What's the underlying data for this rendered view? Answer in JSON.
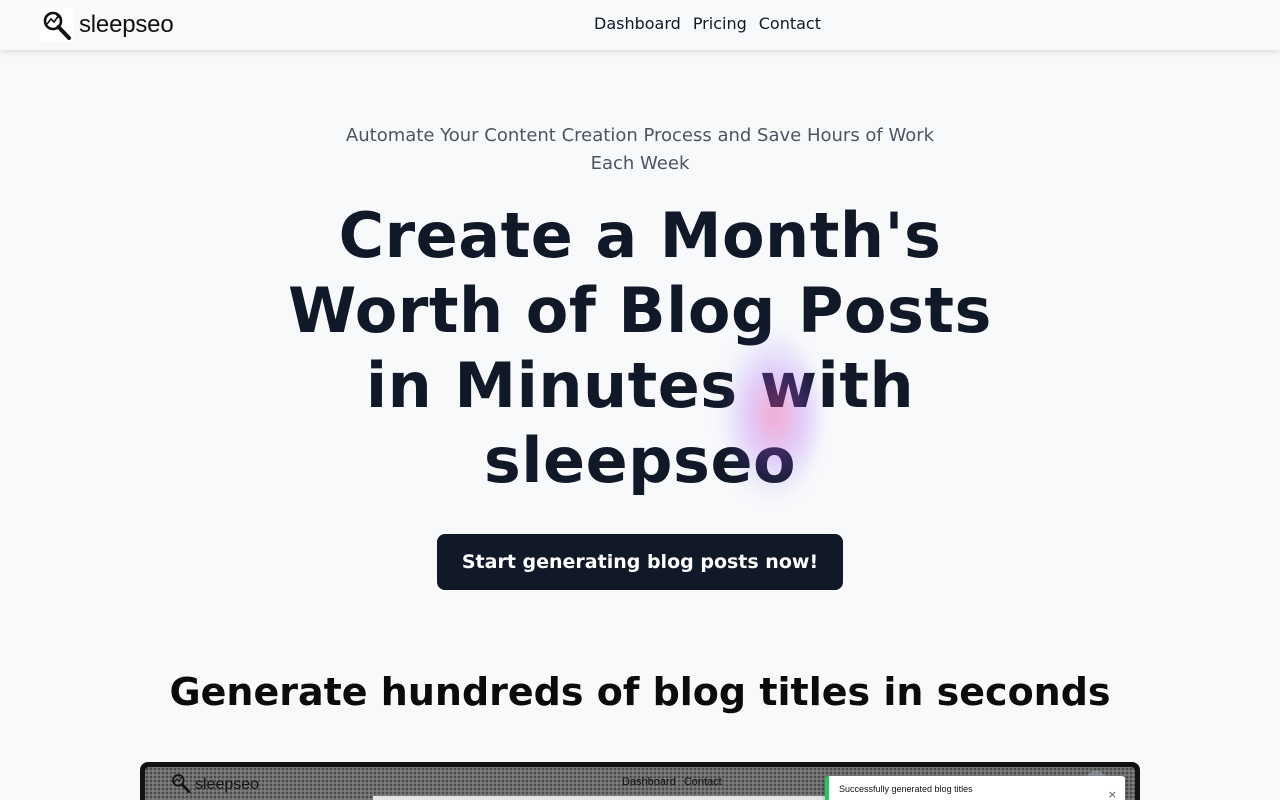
{
  "header": {
    "logo_text": "sleepseo",
    "logo_icon": "magnifier-arrow-icon",
    "nav": [
      "Dashboard",
      "Pricing",
      "Contact"
    ]
  },
  "hero": {
    "tagline": "Automate Your Content Creation Process and Save Hours of Work Each Week",
    "headline": "Create a Month's Worth of Blog Posts in Minutes with sleepseo",
    "cta_label": "Start generating blog posts now!"
  },
  "section": {
    "title": "Generate hundreds of blog titles in seconds"
  },
  "preview": {
    "logo_text": "sleepseo",
    "nav": [
      "Dashboard",
      "Contact"
    ],
    "toast_text": "Successfully generated blog titles",
    "toast_close": "×"
  },
  "colors": {
    "background": "#f8f9fb",
    "primary": "#111827",
    "muted_text": "#4b5563",
    "toast_success": "#22c55e"
  }
}
